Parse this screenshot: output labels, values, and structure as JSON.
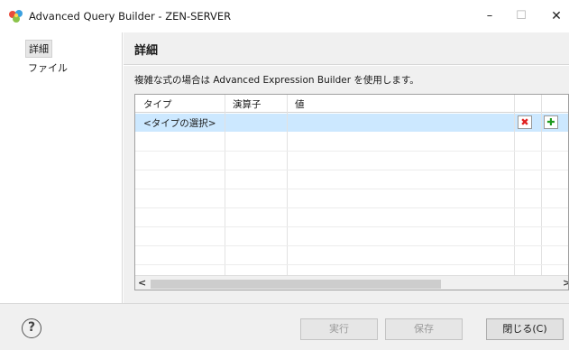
{
  "window": {
    "title": "Advanced Query Builder - ZEN-SERVER",
    "minimize": "–",
    "maximize": "☐",
    "close": "✕"
  },
  "sidebar": {
    "items": [
      {
        "label": "詳細",
        "selected": true
      },
      {
        "label": "ファイル",
        "selected": false
      }
    ]
  },
  "header": {
    "title": "詳細"
  },
  "main": {
    "description": "複雑な式の場合は Advanced Expression Builder を使用します。",
    "table": {
      "columns": [
        "タイプ",
        "演算子",
        "値"
      ],
      "rows": [
        {
          "type": "<タイプの選択>",
          "operator": "",
          "value": "",
          "selected": true
        }
      ],
      "delete_symbol": "✖",
      "add_symbol": "✚"
    },
    "scrollbar": {
      "left": "<",
      "right": ">"
    }
  },
  "footer": {
    "help_symbol": "?",
    "run_label": "実行",
    "save_label": "保存",
    "close_label": "閉じる(C)"
  },
  "colors": {
    "selected_row": "#cce8ff",
    "delete": "#e02020",
    "add": "#1f9a1f",
    "panel": "#f0f0f0"
  }
}
